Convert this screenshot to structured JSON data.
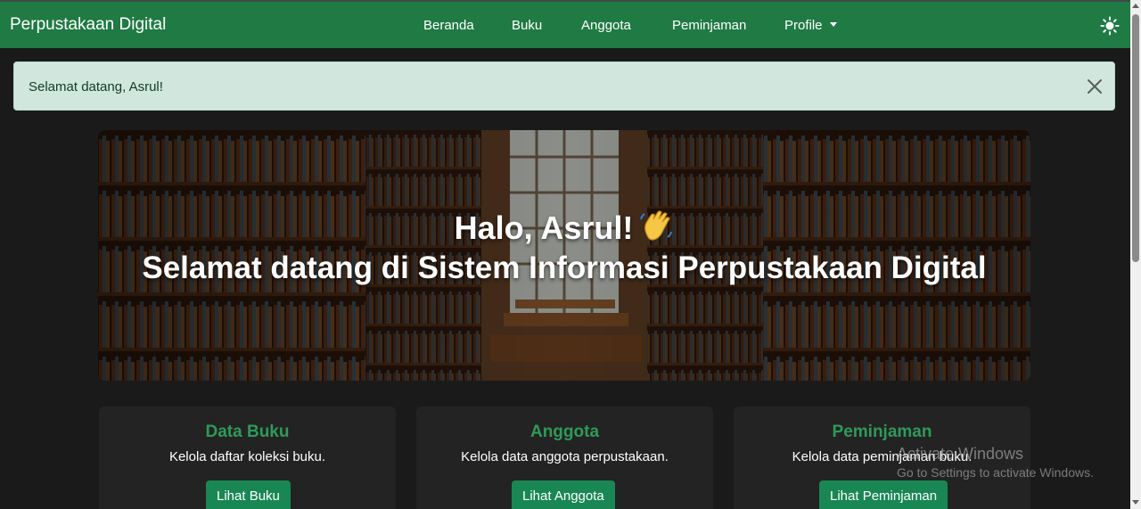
{
  "navbar": {
    "brand": "Perpustakaan Digital",
    "links": [
      {
        "label": "Beranda"
      },
      {
        "label": "Buku"
      },
      {
        "label": "Anggota"
      },
      {
        "label": "Peminjaman"
      },
      {
        "label": "Profile"
      }
    ],
    "theme_icon": "sun-icon",
    "color": "#1f7a43"
  },
  "alert": {
    "message": "Selamat datang, Asrul!",
    "close_icon": "close-icon",
    "background": "#d1e7dd"
  },
  "hero": {
    "title": "Halo, Asrul!",
    "title_emoji": "waving-hand-icon",
    "subtitle": "Selamat datang di Sistem Informasi Perpustakaan Digital"
  },
  "cards": [
    {
      "title": "Data Buku",
      "text": "Kelola daftar koleksi buku.",
      "button": "Lihat Buku"
    },
    {
      "title": "Anggota",
      "text": "Kelola data anggota perpustakaan.",
      "button": "Lihat Anggota"
    },
    {
      "title": "Peminjaman",
      "text": "Kelola data peminjaman buku.",
      "button": "Lihat Peminjaman"
    }
  ],
  "watermark": {
    "line1": "Activate Windows",
    "line2": "Go to Settings to activate Windows."
  },
  "colors": {
    "accent": "#198754",
    "card_title": "#2e9a5a",
    "background": "#1a1a1a"
  }
}
